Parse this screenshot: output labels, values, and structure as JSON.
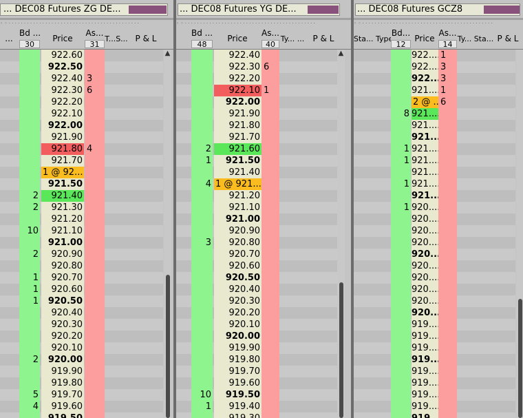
{
  "panels": [
    {
      "description": "... DEC08 Futures ZG     DE...",
      "header": {
        "bid_label": "Bd ...",
        "bid_count": "30",
        "price_label": "Price",
        "ask_label": "As...",
        "ask_count": "31",
        "extra_label": "T...S...",
        "pnl_label": "P & L",
        "left_label": "..."
      },
      "rows": [
        {
          "bid": "",
          "price": "922.60",
          "ask": "",
          "bold": false,
          "hl": ""
        },
        {
          "bid": "",
          "price": "922.50",
          "ask": "",
          "bold": true,
          "hl": ""
        },
        {
          "bid": "",
          "price": "922.40",
          "ask": "3",
          "bold": false,
          "hl": ""
        },
        {
          "bid": "",
          "price": "922.30",
          "ask": "6",
          "bold": false,
          "hl": ""
        },
        {
          "bid": "",
          "price": "922.20",
          "ask": "",
          "bold": false,
          "hl": ""
        },
        {
          "bid": "",
          "price": "922.10",
          "ask": "",
          "bold": false,
          "hl": ""
        },
        {
          "bid": "",
          "price": "922.00",
          "ask": "",
          "bold": true,
          "hl": ""
        },
        {
          "bid": "",
          "price": "921.90",
          "ask": "",
          "bold": false,
          "hl": ""
        },
        {
          "bid": "",
          "price": "921.80",
          "ask": "4",
          "bold": false,
          "hl": "red"
        },
        {
          "bid": "",
          "price": "921.70",
          "ask": "",
          "bold": false,
          "hl": ""
        },
        {
          "bid": "",
          "price": "1 @ 92...",
          "ask": "",
          "bold": false,
          "hl": "orange"
        },
        {
          "bid": "",
          "price": "921.50",
          "ask": "",
          "bold": true,
          "hl": ""
        },
        {
          "bid": "2",
          "price": "921.40",
          "ask": "",
          "bold": false,
          "hl": "green"
        },
        {
          "bid": "2",
          "price": "921.30",
          "ask": "",
          "bold": false,
          "hl": ""
        },
        {
          "bid": "",
          "price": "921.20",
          "ask": "",
          "bold": false,
          "hl": ""
        },
        {
          "bid": "10",
          "price": "921.10",
          "ask": "",
          "bold": false,
          "hl": ""
        },
        {
          "bid": "",
          "price": "921.00",
          "ask": "",
          "bold": true,
          "hl": ""
        },
        {
          "bid": "2",
          "price": "920.90",
          "ask": "",
          "bold": false,
          "hl": ""
        },
        {
          "bid": "",
          "price": "920.80",
          "ask": "",
          "bold": false,
          "hl": ""
        },
        {
          "bid": "1",
          "price": "920.70",
          "ask": "",
          "bold": false,
          "hl": ""
        },
        {
          "bid": "1",
          "price": "920.60",
          "ask": "",
          "bold": false,
          "hl": ""
        },
        {
          "bid": "1",
          "price": "920.50",
          "ask": "",
          "bold": true,
          "hl": ""
        },
        {
          "bid": "",
          "price": "920.40",
          "ask": "",
          "bold": false,
          "hl": ""
        },
        {
          "bid": "",
          "price": "920.30",
          "ask": "",
          "bold": false,
          "hl": ""
        },
        {
          "bid": "",
          "price": "920.20",
          "ask": "",
          "bold": false,
          "hl": ""
        },
        {
          "bid": "",
          "price": "920.10",
          "ask": "",
          "bold": false,
          "hl": ""
        },
        {
          "bid": "2",
          "price": "920.00",
          "ask": "",
          "bold": true,
          "hl": ""
        },
        {
          "bid": "",
          "price": "919.90",
          "ask": "",
          "bold": false,
          "hl": ""
        },
        {
          "bid": "",
          "price": "919.80",
          "ask": "",
          "bold": false,
          "hl": ""
        },
        {
          "bid": "5",
          "price": "919.70",
          "ask": "",
          "bold": false,
          "hl": ""
        },
        {
          "bid": "4",
          "price": "919.60",
          "ask": "",
          "bold": false,
          "hl": ""
        },
        {
          "bid": "",
          "price": "919.50",
          "ask": "",
          "bold": true,
          "hl": ""
        }
      ]
    },
    {
      "description": "... DEC08 Futures YG     DE...",
      "header": {
        "bid_label": "Bd ...",
        "bid_count": "48",
        "price_label": "Price",
        "ask_label": "As...",
        "ask_count": "40",
        "extra_label": "Ty... ...",
        "pnl_label": "P & L",
        "left_label": ""
      },
      "rows": [
        {
          "bid": "",
          "price": "922.40",
          "ask": "",
          "bold": false,
          "hl": ""
        },
        {
          "bid": "",
          "price": "922.30",
          "ask": "6",
          "bold": false,
          "hl": ""
        },
        {
          "bid": "",
          "price": "922.20",
          "ask": "",
          "bold": false,
          "hl": ""
        },
        {
          "bid": "",
          "price": "922.10",
          "ask": "1",
          "bold": false,
          "hl": "red"
        },
        {
          "bid": "",
          "price": "922.00",
          "ask": "",
          "bold": true,
          "hl": ""
        },
        {
          "bid": "",
          "price": "921.90",
          "ask": "",
          "bold": false,
          "hl": ""
        },
        {
          "bid": "",
          "price": "921.80",
          "ask": "",
          "bold": false,
          "hl": ""
        },
        {
          "bid": "",
          "price": "921.70",
          "ask": "",
          "bold": false,
          "hl": ""
        },
        {
          "bid": "2",
          "price": "921.60",
          "ask": "",
          "bold": false,
          "hl": "green"
        },
        {
          "bid": "1",
          "price": "921.50",
          "ask": "",
          "bold": true,
          "hl": ""
        },
        {
          "bid": "",
          "price": "921.40",
          "ask": "",
          "bold": false,
          "hl": ""
        },
        {
          "bid": "4",
          "price": "1 @ 921...",
          "ask": "",
          "bold": false,
          "hl": "orange"
        },
        {
          "bid": "",
          "price": "921.20",
          "ask": "",
          "bold": false,
          "hl": ""
        },
        {
          "bid": "",
          "price": "921.10",
          "ask": "",
          "bold": false,
          "hl": ""
        },
        {
          "bid": "",
          "price": "921.00",
          "ask": "",
          "bold": true,
          "hl": ""
        },
        {
          "bid": "",
          "price": "920.90",
          "ask": "",
          "bold": false,
          "hl": ""
        },
        {
          "bid": "3",
          "price": "920.80",
          "ask": "",
          "bold": false,
          "hl": ""
        },
        {
          "bid": "",
          "price": "920.70",
          "ask": "",
          "bold": false,
          "hl": ""
        },
        {
          "bid": "",
          "price": "920.60",
          "ask": "",
          "bold": false,
          "hl": ""
        },
        {
          "bid": "",
          "price": "920.50",
          "ask": "",
          "bold": true,
          "hl": ""
        },
        {
          "bid": "",
          "price": "920.40",
          "ask": "",
          "bold": false,
          "hl": ""
        },
        {
          "bid": "",
          "price": "920.30",
          "ask": "",
          "bold": false,
          "hl": ""
        },
        {
          "bid": "",
          "price": "920.20",
          "ask": "",
          "bold": false,
          "hl": ""
        },
        {
          "bid": "",
          "price": "920.10",
          "ask": "",
          "bold": false,
          "hl": ""
        },
        {
          "bid": "",
          "price": "920.00",
          "ask": "",
          "bold": true,
          "hl": ""
        },
        {
          "bid": "",
          "price": "919.90",
          "ask": "",
          "bold": false,
          "hl": ""
        },
        {
          "bid": "",
          "price": "919.80",
          "ask": "",
          "bold": false,
          "hl": ""
        },
        {
          "bid": "",
          "price": "919.70",
          "ask": "",
          "bold": false,
          "hl": ""
        },
        {
          "bid": "",
          "price": "919.60",
          "ask": "",
          "bold": false,
          "hl": ""
        },
        {
          "bid": "10",
          "price": "919.50",
          "ask": "",
          "bold": true,
          "hl": ""
        },
        {
          "bid": "1",
          "price": "919.40",
          "ask": "",
          "bold": false,
          "hl": ""
        },
        {
          "bid": "",
          "price": "919.30",
          "ask": "",
          "bold": false,
          "hl": ""
        }
      ]
    },
    {
      "description": "... DEC08 Futures GCZ8",
      "header": {
        "bid_label": "Bd...",
        "bid_count": "12",
        "price_label": "Price",
        "ask_label": "As...",
        "ask_count": "14",
        "extra_label": "Ty... Sta...",
        "pnl_label": "P & L",
        "left_label": "Sta... Type"
      },
      "rows": [
        {
          "bid": "",
          "price": "922....",
          "ask": "1",
          "bold": false,
          "hl": ""
        },
        {
          "bid": "",
          "price": "922....",
          "ask": "3",
          "bold": false,
          "hl": ""
        },
        {
          "bid": "",
          "price": "922....",
          "ask": "3",
          "bold": true,
          "hl": ""
        },
        {
          "bid": "",
          "price": "921....",
          "ask": "1",
          "bold": false,
          "hl": ""
        },
        {
          "bid": "",
          "price": "2 @ ...",
          "ask": "6",
          "bold": false,
          "hl": "orange"
        },
        {
          "bid": "8",
          "price": "921....",
          "ask": "",
          "bold": false,
          "hl": "green"
        },
        {
          "bid": "",
          "price": "921....",
          "ask": "",
          "bold": false,
          "hl": ""
        },
        {
          "bid": "",
          "price": "921....",
          "ask": "",
          "bold": true,
          "hl": ""
        },
        {
          "bid": "1",
          "price": "921....",
          "ask": "",
          "bold": false,
          "hl": ""
        },
        {
          "bid": "1",
          "price": "921....",
          "ask": "",
          "bold": false,
          "hl": ""
        },
        {
          "bid": "",
          "price": "921....",
          "ask": "",
          "bold": false,
          "hl": ""
        },
        {
          "bid": "1",
          "price": "921....",
          "ask": "",
          "bold": false,
          "hl": ""
        },
        {
          "bid": "",
          "price": "921....",
          "ask": "",
          "bold": true,
          "hl": ""
        },
        {
          "bid": "1",
          "price": "920....",
          "ask": "",
          "bold": false,
          "hl": ""
        },
        {
          "bid": "",
          "price": "920....",
          "ask": "",
          "bold": false,
          "hl": ""
        },
        {
          "bid": "",
          "price": "920....",
          "ask": "",
          "bold": false,
          "hl": ""
        },
        {
          "bid": "",
          "price": "920....",
          "ask": "",
          "bold": false,
          "hl": ""
        },
        {
          "bid": "",
          "price": "920....",
          "ask": "",
          "bold": true,
          "hl": ""
        },
        {
          "bid": "",
          "price": "920....",
          "ask": "",
          "bold": false,
          "hl": ""
        },
        {
          "bid": "",
          "price": "920....",
          "ask": "",
          "bold": false,
          "hl": ""
        },
        {
          "bid": "",
          "price": "920....",
          "ask": "",
          "bold": false,
          "hl": ""
        },
        {
          "bid": "",
          "price": "920....",
          "ask": "",
          "bold": false,
          "hl": ""
        },
        {
          "bid": "",
          "price": "920....",
          "ask": "",
          "bold": true,
          "hl": ""
        },
        {
          "bid": "",
          "price": "919....",
          "ask": "",
          "bold": false,
          "hl": ""
        },
        {
          "bid": "",
          "price": "919....",
          "ask": "",
          "bold": false,
          "hl": ""
        },
        {
          "bid": "",
          "price": "919....",
          "ask": "",
          "bold": false,
          "hl": ""
        },
        {
          "bid": "",
          "price": "919....",
          "ask": "",
          "bold": true,
          "hl": ""
        },
        {
          "bid": "",
          "price": "919....",
          "ask": "",
          "bold": false,
          "hl": ""
        },
        {
          "bid": "",
          "price": "919....",
          "ask": "",
          "bold": false,
          "hl": ""
        },
        {
          "bid": "",
          "price": "919....",
          "ask": "",
          "bold": false,
          "hl": ""
        },
        {
          "bid": "",
          "price": "919....",
          "ask": "",
          "bold": false,
          "hl": ""
        },
        {
          "bid": "",
          "price": "919....",
          "ask": "",
          "bold": true,
          "hl": ""
        }
      ]
    }
  ],
  "colors": {
    "bid": "#8ef48e",
    "ask": "#fd9e9e",
    "price": "#e9e9d0",
    "row_dark": "#bebebe",
    "row_light": "#c9c9c9",
    "highlight_red": "#f25d5d",
    "highlight_green": "#5ae85a",
    "highlight_orange": "#fbbc1f",
    "position": "#88527c"
  },
  "icons": {
    "scroll_up": "▲"
  }
}
